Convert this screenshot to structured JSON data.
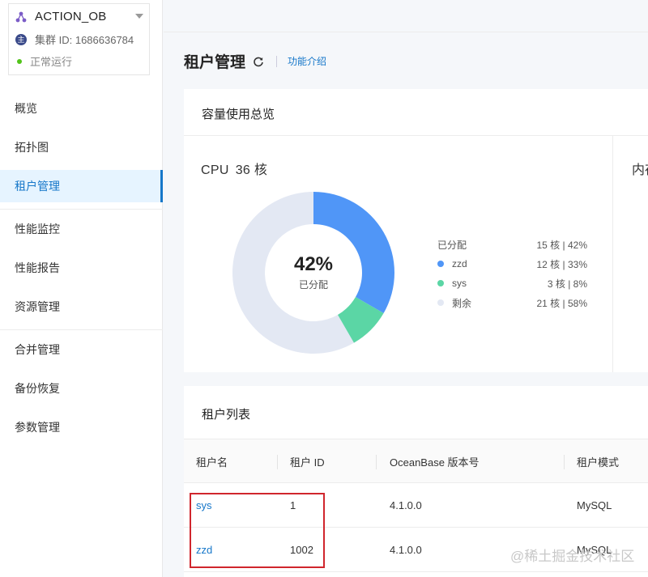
{
  "sidebar": {
    "cluster": {
      "name": "ACTION_OB",
      "id_icon": "主",
      "id_text": "集群 ID: 1686636784",
      "status": "正常运行",
      "status_color": "#52c41a"
    },
    "items": [
      {
        "label": "概览"
      },
      {
        "label": "拓扑图"
      },
      {
        "label": "租户管理",
        "active": true
      },
      {
        "label": "性能监控"
      },
      {
        "label": "性能报告"
      },
      {
        "label": "资源管理"
      },
      {
        "label": "合并管理"
      },
      {
        "label": "备份恢复"
      },
      {
        "label": "参数管理"
      }
    ]
  },
  "header": {
    "title": "租户管理",
    "link": "功能介绍"
  },
  "capacity": {
    "title": "容量使用总览",
    "cpu_label": "CPU",
    "cpu_total": "36 核",
    "center_percent": "42%",
    "center_label": "已分配",
    "allocated_label": "已分配",
    "allocated_value": "15 核 | 42%",
    "legend": [
      {
        "name": "zzd",
        "value": "12 核 | 33%",
        "color": "#5096f7"
      },
      {
        "name": "sys",
        "value": "3 核 | 8%",
        "color": "#5bd6a5"
      },
      {
        "name": "剩余",
        "value": "21 核 | 58%",
        "color": "#e3e8f3"
      }
    ],
    "memory_label": "内存"
  },
  "tenant_list": {
    "title": "租户列表",
    "columns": [
      "租户名",
      "租户 ID",
      "OceanBase 版本号",
      "租户模式"
    ],
    "rows": [
      {
        "name": "sys",
        "id": "1",
        "version": "4.1.0.0",
        "mode": "MySQL"
      },
      {
        "name": "zzd",
        "id": "1002",
        "version": "4.1.0.0",
        "mode": "MySQL"
      }
    ]
  },
  "watermark": "@稀土掘金技术社区",
  "colors": {
    "accent": "#1677c9",
    "highlight_box": "#d0262d"
  }
}
